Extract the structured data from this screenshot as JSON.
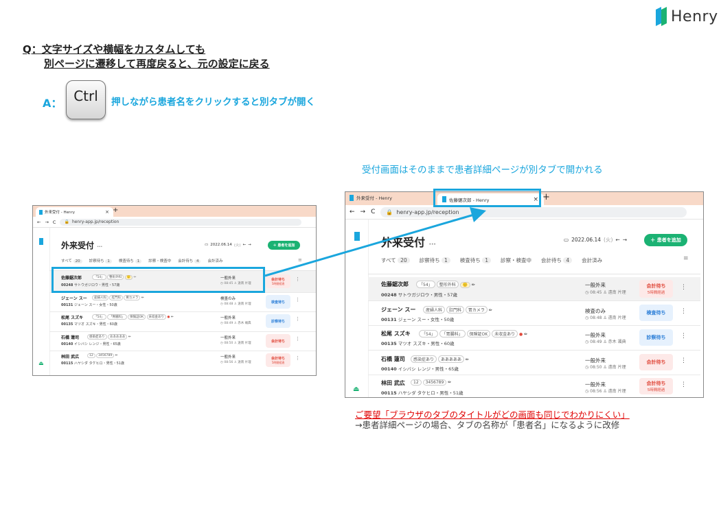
{
  "logo": {
    "text": "Henry"
  },
  "question": {
    "line1": "Q：文字サイズや横幅をカスタムしても",
    "line2": "別ページに遷移して再度戻ると、元の設定に戻る"
  },
  "answer": {
    "label": "A：",
    "key": "Ctrl",
    "text": "押しながら患者名をクリックすると別タブが開く"
  },
  "caption": "受付画面はそのままで患者詳細ページが別タブで開かれる",
  "request": {
    "title": "ご要望「ブラウザのタブのタイトルがどの画面も同じでわかりにくい」",
    "sub": "→患者詳細ページの場合、タブの名称が「患者名」になるように改修"
  },
  "colors": {
    "accent": "#1aa6dd",
    "brand_green": "#1bb273",
    "tab_bar": "#f8d9c8",
    "request": "#e00000",
    "highlight": "#1aa6dd"
  },
  "left_window": {
    "tab_label": "外来受付 - Henry",
    "tab_close": "×",
    "new_tab": "+",
    "url": "henry-app.jp/reception"
  },
  "right_window": {
    "tab1_label": "外来受付 - Henry",
    "tab2_label": "佐藤鋸次郎 - Henry",
    "tab_close": "×",
    "new_tab": "+",
    "url": "henry-app.jp/reception"
  },
  "reception": {
    "title": "外来受付",
    "title_more": "···",
    "date": "2022.06.14",
    "weekday": "(火)",
    "add_button": "＋ 患者を追加",
    "filters": [
      {
        "label": "すべて",
        "count": "20"
      },
      {
        "label": "診察待ち",
        "count": "1"
      },
      {
        "label": "検査待ち",
        "count": "1"
      },
      {
        "label": "診察・検査中",
        "count": ""
      },
      {
        "label": "会計待ち",
        "count": "4"
      },
      {
        "label": "会計済み",
        "count": ""
      }
    ],
    "rows": [
      {
        "name": "佐藤鋸次郎",
        "tags": [
          "「54」",
          "整形外科",
          "🙂",
          "✏"
        ],
        "id": "00248",
        "info": "サトウガジロウ・男性・57歳",
        "visit": "一般外来",
        "time": "08:45",
        "doctor": "遠南 片理",
        "status": "会計待ち",
        "status_sub": "5時間経過",
        "status_color": "red"
      },
      {
        "name": "ジェーン スー",
        "tags": [
          "産婦人科",
          "肛門科",
          "胃カメラ",
          "✏"
        ],
        "id": "00131",
        "info": "ジェーン スー・女性・50歳",
        "visit": "検査のみ",
        "time": "08:48",
        "doctor": "遠南 片理",
        "status": "検査待ち",
        "status_sub": "",
        "status_color": "blue"
      },
      {
        "name": "松尾 スズキ",
        "tags": [
          "「54」",
          "「胃腸科」",
          "保険証OK",
          "未収金あり",
          "●",
          "✏"
        ],
        "id": "00135",
        "info": "マツオ スズキ・男性・60歳",
        "visit": "一般外来",
        "time": "08:49",
        "doctor": "赤木 颯典",
        "status": "診察待ち",
        "status_sub": "",
        "status_color": "blue"
      },
      {
        "name": "石橋 蓮司",
        "tags": [
          "感染症あり",
          "あああああ",
          "✏"
        ],
        "id": "00140",
        "info": "イシバシ レンジ・男性・65歳",
        "visit": "一般外来",
        "time": "08:50",
        "doctor": "遠南 片理",
        "status": "会計待ち",
        "status_sub": "",
        "status_color": "red"
      },
      {
        "name": "林田 武広",
        "tags": [
          "12",
          "3456789",
          "✏"
        ],
        "id": "00115",
        "info": "ハヤシダ タケヒロ・男性・51歳",
        "visit": "一般外来",
        "time": "08:56",
        "doctor": "遠南 片理",
        "status": "会計待ち",
        "status_sub": "5時間経過",
        "status_color": "red"
      }
    ]
  }
}
